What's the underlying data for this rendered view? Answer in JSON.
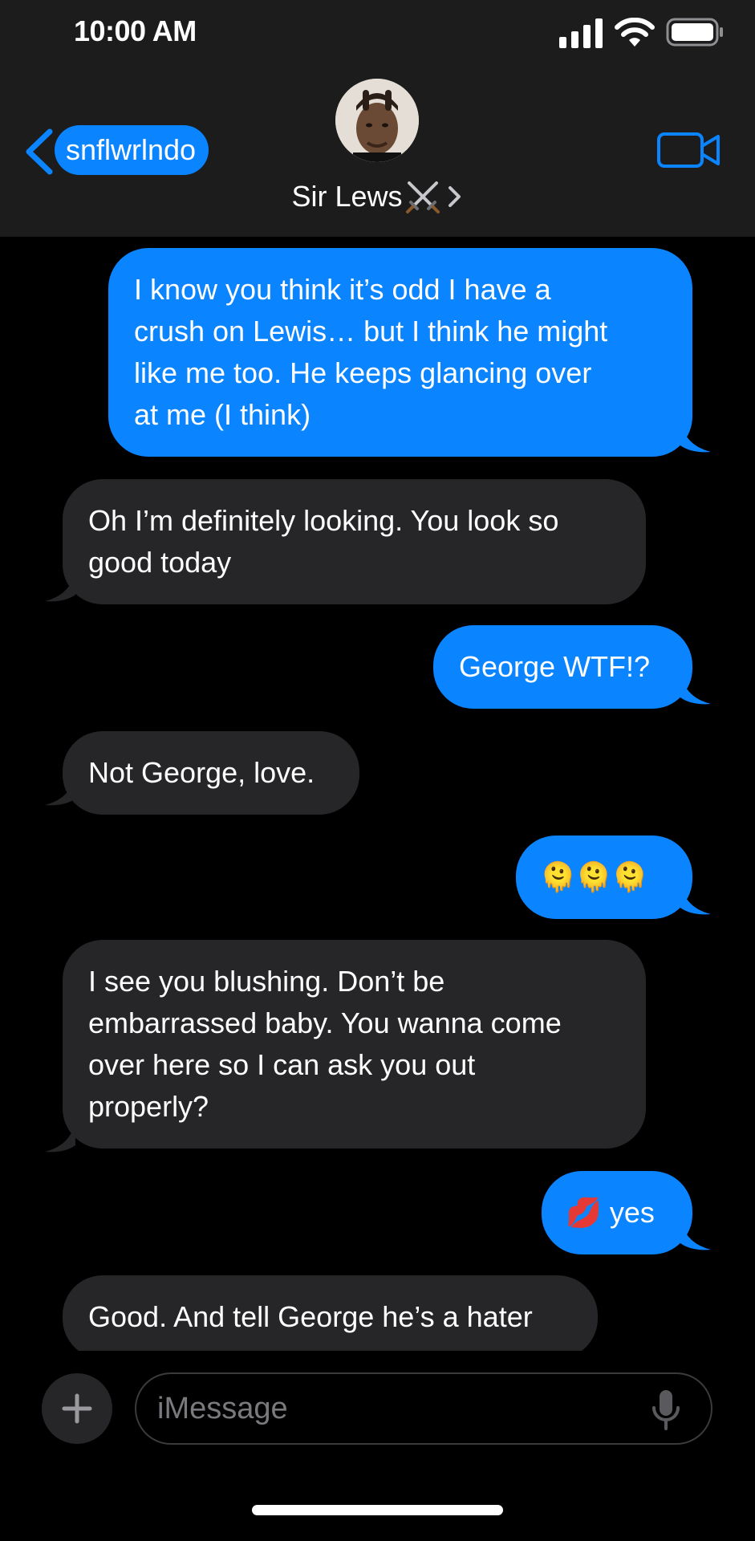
{
  "status_bar": {
    "time": "10:00 AM"
  },
  "header": {
    "back_label": "snflwrlndo",
    "contact_name": "Sir Lews",
    "icons": {
      "back": "chevron-left-icon",
      "video": "video-camera-icon",
      "name_emoji": "crossed-swords-icon",
      "details": "chevron-right-icon"
    }
  },
  "messages": [
    {
      "from": "me",
      "lines": [
        "I know you think it’s odd I have a",
        "crush on Lewis… but I think he might",
        "like me too. He keeps glancing over",
        "at me (I think)"
      ]
    },
    {
      "from": "them",
      "lines": [
        "Oh I’m definitely looking. You look so",
        "good today"
      ]
    },
    {
      "from": "me",
      "lines": [
        "George WTF!?"
      ]
    },
    {
      "from": "them",
      "lines": [
        "Not George, love."
      ]
    },
    {
      "from": "me",
      "lines": [
        "🫠🫠🫠"
      ]
    },
    {
      "from": "them",
      "lines": [
        "I see you blushing. Don’t be",
        "embarrassed baby. You wanna come",
        "over here so I can ask you out",
        "properly?"
      ]
    },
    {
      "from": "me",
      "lines": [
        "💋 yes"
      ]
    },
    {
      "from": "them",
      "lines": [
        "Good. And tell George he’s a hater"
      ]
    }
  ],
  "input": {
    "placeholder": "iMessage"
  },
  "colors": {
    "sent_bubble": "#0a84ff",
    "received_bubble": "#262628",
    "header_bg": "#1c1c1c",
    "background": "#000000"
  }
}
